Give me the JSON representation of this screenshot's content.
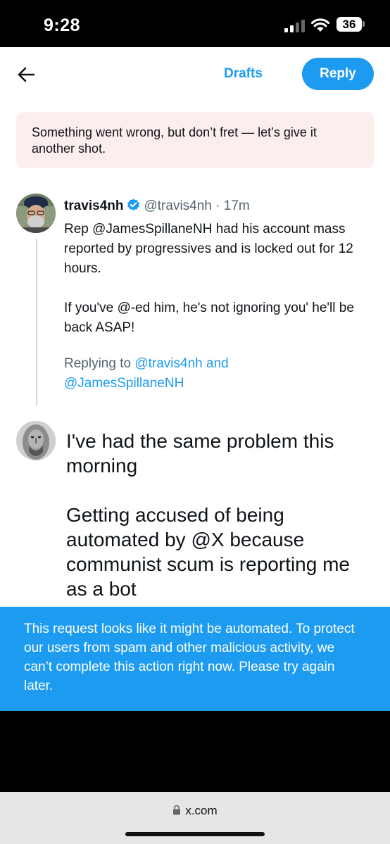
{
  "status_bar": {
    "time": "9:28",
    "battery": "36"
  },
  "header": {
    "drafts_label": "Drafts",
    "reply_label": "Reply"
  },
  "error_banner": {
    "text": "Something went wrong, but don’t fret — let’s give it another shot."
  },
  "tweet": {
    "display_name": "travis4nh",
    "handle": "@travis4nh",
    "separator": " · ",
    "time_ago": "17m",
    "paragraphs": [
      "Rep @JamesSpillaneNH had his account mass reported by progressives and is locked out for 12 hours.",
      "If you've @-ed him, he's not ignoring you' he'll be back ASAP!"
    ],
    "replying_prefix": "Replying to ",
    "replying_user1": "@travis4nh",
    "replying_and": " and ",
    "replying_user2": "@JamesSpillaneNH"
  },
  "compose": {
    "paragraphs": [
      "I've had the same problem this morning",
      "Getting accused of being automated by @X because communist scum is reporting me as a bot"
    ]
  },
  "toast": {
    "text": "This request looks like it might be automated. To protect our users from spam and other malicious activity, we can’t complete this action right now. Please try again later."
  },
  "browser": {
    "url": "x.com"
  },
  "colors": {
    "accent": "#1d9bf0",
    "error_bg": "#fdeeee",
    "muted_text": "#536471"
  }
}
